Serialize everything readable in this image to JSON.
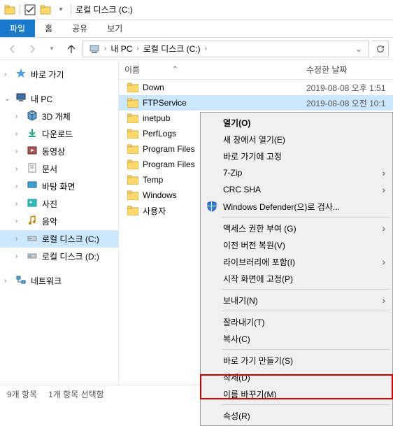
{
  "titlebar": {
    "title": "로컬 디스크 (C:)"
  },
  "ribbon": {
    "file": "파일",
    "home": "홈",
    "share": "공유",
    "view": "보기"
  },
  "breadcrumb": {
    "pc": "내 PC",
    "drive": "로컬 디스크 (C:)"
  },
  "sidebar": {
    "quick": "바로 가기",
    "pc": "내 PC",
    "items": [
      {
        "label": "3D 개체"
      },
      {
        "label": "다운로드"
      },
      {
        "label": "동영상"
      },
      {
        "label": "문서"
      },
      {
        "label": "바탕 화면"
      },
      {
        "label": "사진"
      },
      {
        "label": "음악"
      },
      {
        "label": "로컬 디스크 (C:)"
      },
      {
        "label": "로컬 디스크 (D:)"
      }
    ],
    "network": "네트워크"
  },
  "columns": {
    "name": "이름",
    "modified": "수정한 날짜"
  },
  "files": [
    {
      "name": "Down",
      "date": "2019-08-08 오후 1:51"
    },
    {
      "name": "FTPService",
      "date": "2019-08-08 오전 10:1"
    },
    {
      "name": "inetpub",
      "date": ""
    },
    {
      "name": "PerfLogs",
      "date": ""
    },
    {
      "name": "Program Files",
      "date": ""
    },
    {
      "name": "Program Files",
      "date": ""
    },
    {
      "name": "Temp",
      "date": ""
    },
    {
      "name": "Windows",
      "date": ""
    },
    {
      "name": "사용자",
      "date": ""
    }
  ],
  "status": {
    "count": "9개 항목",
    "selected": "1개 항목 선택함"
  },
  "ctx": {
    "open": "열기(O)",
    "open_new": "새 창에서 열기(E)",
    "pin_quick": "바로 가기에 고정",
    "sevenzip": "7-Zip",
    "crc": "CRC SHA",
    "defender": "Windows Defender(으)로 검사...",
    "access": "액세스 권한 부여 (G)",
    "restore": "이전 버전 복원(V)",
    "library": "라이브러리에 포함(I)",
    "pin_start": "시작 화면에 고정(P)",
    "send": "보내기(N)",
    "cut": "잘라내기(T)",
    "copy": "복사(C)",
    "shortcut": "바로 가기 만들기(S)",
    "delete": "삭제(D)",
    "rename": "이름 바꾸기(M)",
    "properties": "속성(R)"
  }
}
